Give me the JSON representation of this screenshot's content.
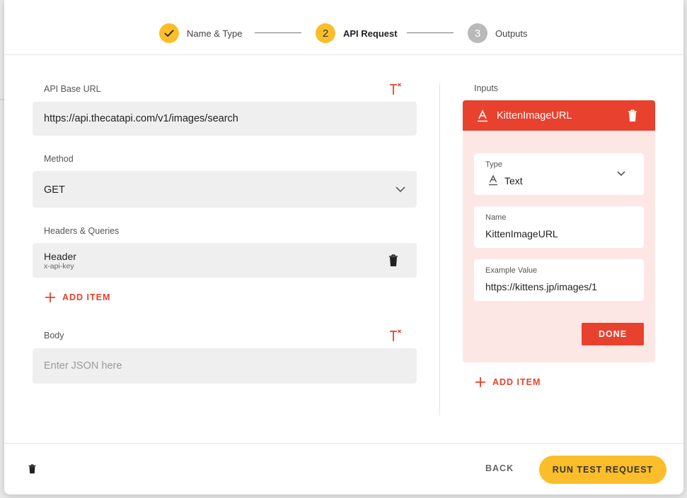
{
  "stepper": {
    "steps": [
      {
        "number": "",
        "label": "Name & Type",
        "status": "completed"
      },
      {
        "number": "2",
        "label": "API Request",
        "status": "active"
      },
      {
        "number": "3",
        "label": "Outputs",
        "status": "upcoming"
      }
    ]
  },
  "form": {
    "base_url": {
      "label": "API Base URL",
      "value": "https://api.thecatapi.com/v1/images/search"
    },
    "method": {
      "label": "Method",
      "value": "GET"
    },
    "headers": {
      "label": "Headers & Queries",
      "items": [
        {
          "type": "Header",
          "key": "x-api-key"
        }
      ],
      "add_label": "ADD ITEM"
    },
    "body": {
      "label": "Body",
      "placeholder": "Enter JSON here"
    }
  },
  "inputs": {
    "label": "Inputs",
    "card": {
      "title": "KittenImageURL",
      "type_label": "Type",
      "type_value": "Text",
      "name_label": "Name",
      "name_value": "KittenImageURL",
      "example_label": "Example Value",
      "example_value": "https://kittens.jp/images/1",
      "done_label": "DONE"
    },
    "add_label": "ADD ITEM"
  },
  "footer": {
    "back_label": "BACK",
    "run_label": "RUN TEST REQUEST"
  },
  "colors": {
    "accent_yellow": "#fbbd2a",
    "accent_red": "#e8412d",
    "card_bg": "#fde7e5",
    "field_bg": "#efefef"
  }
}
